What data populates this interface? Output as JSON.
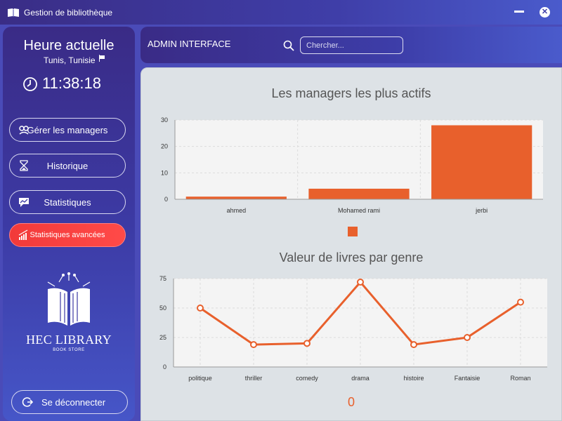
{
  "window": {
    "title": "Gestion de bibliothèque"
  },
  "sidebar": {
    "clock_title": "Heure actuelle",
    "location": "Tunis, Tunisie",
    "time": "11:38:18",
    "items": [
      {
        "label": "Gérer les managers",
        "icon": "managers-icon"
      },
      {
        "label": "Historique",
        "icon": "hourglass-icon"
      },
      {
        "label": "Statistiques",
        "icon": "stats-chat-icon"
      },
      {
        "label": "Statistiques avancées",
        "icon": "advanced-stats-icon",
        "active": true
      }
    ],
    "logo_title": "HEC LIBRARY",
    "logo_subtitle": "BOOK STORE",
    "logout_label": "Se déconnecter"
  },
  "header": {
    "title": "ADMIN INTERFACE",
    "search_placeholder": "Chercher..."
  },
  "colors": {
    "accent": "#e8602c",
    "active_button": "#f23a3a",
    "sidebar": "#3c3aa4"
  },
  "chart_data": [
    {
      "type": "bar",
      "title": "Les managers les plus actifs",
      "categories": [
        "ahmed",
        "Mohamed rami",
        "jerbi"
      ],
      "values": [
        1,
        4,
        28
      ],
      "ylim": [
        0,
        30
      ],
      "yticks": [
        0,
        10,
        20,
        30
      ],
      "grid": true,
      "legend": "bottom",
      "color": "#e8602c"
    },
    {
      "type": "line",
      "title": "Valeur de livres par genre",
      "categories": [
        "politique",
        "thriller",
        "comedy",
        "drama",
        "histoire",
        "Fantaisie",
        "Roman"
      ],
      "values": [
        50,
        19,
        20,
        72,
        19,
        25,
        55
      ],
      "ylim": [
        0,
        75
      ],
      "yticks": [
        0,
        25,
        50,
        75
      ],
      "grid": true,
      "legend": "bottom",
      "legend_text": "0",
      "color": "#e8602c"
    }
  ]
}
